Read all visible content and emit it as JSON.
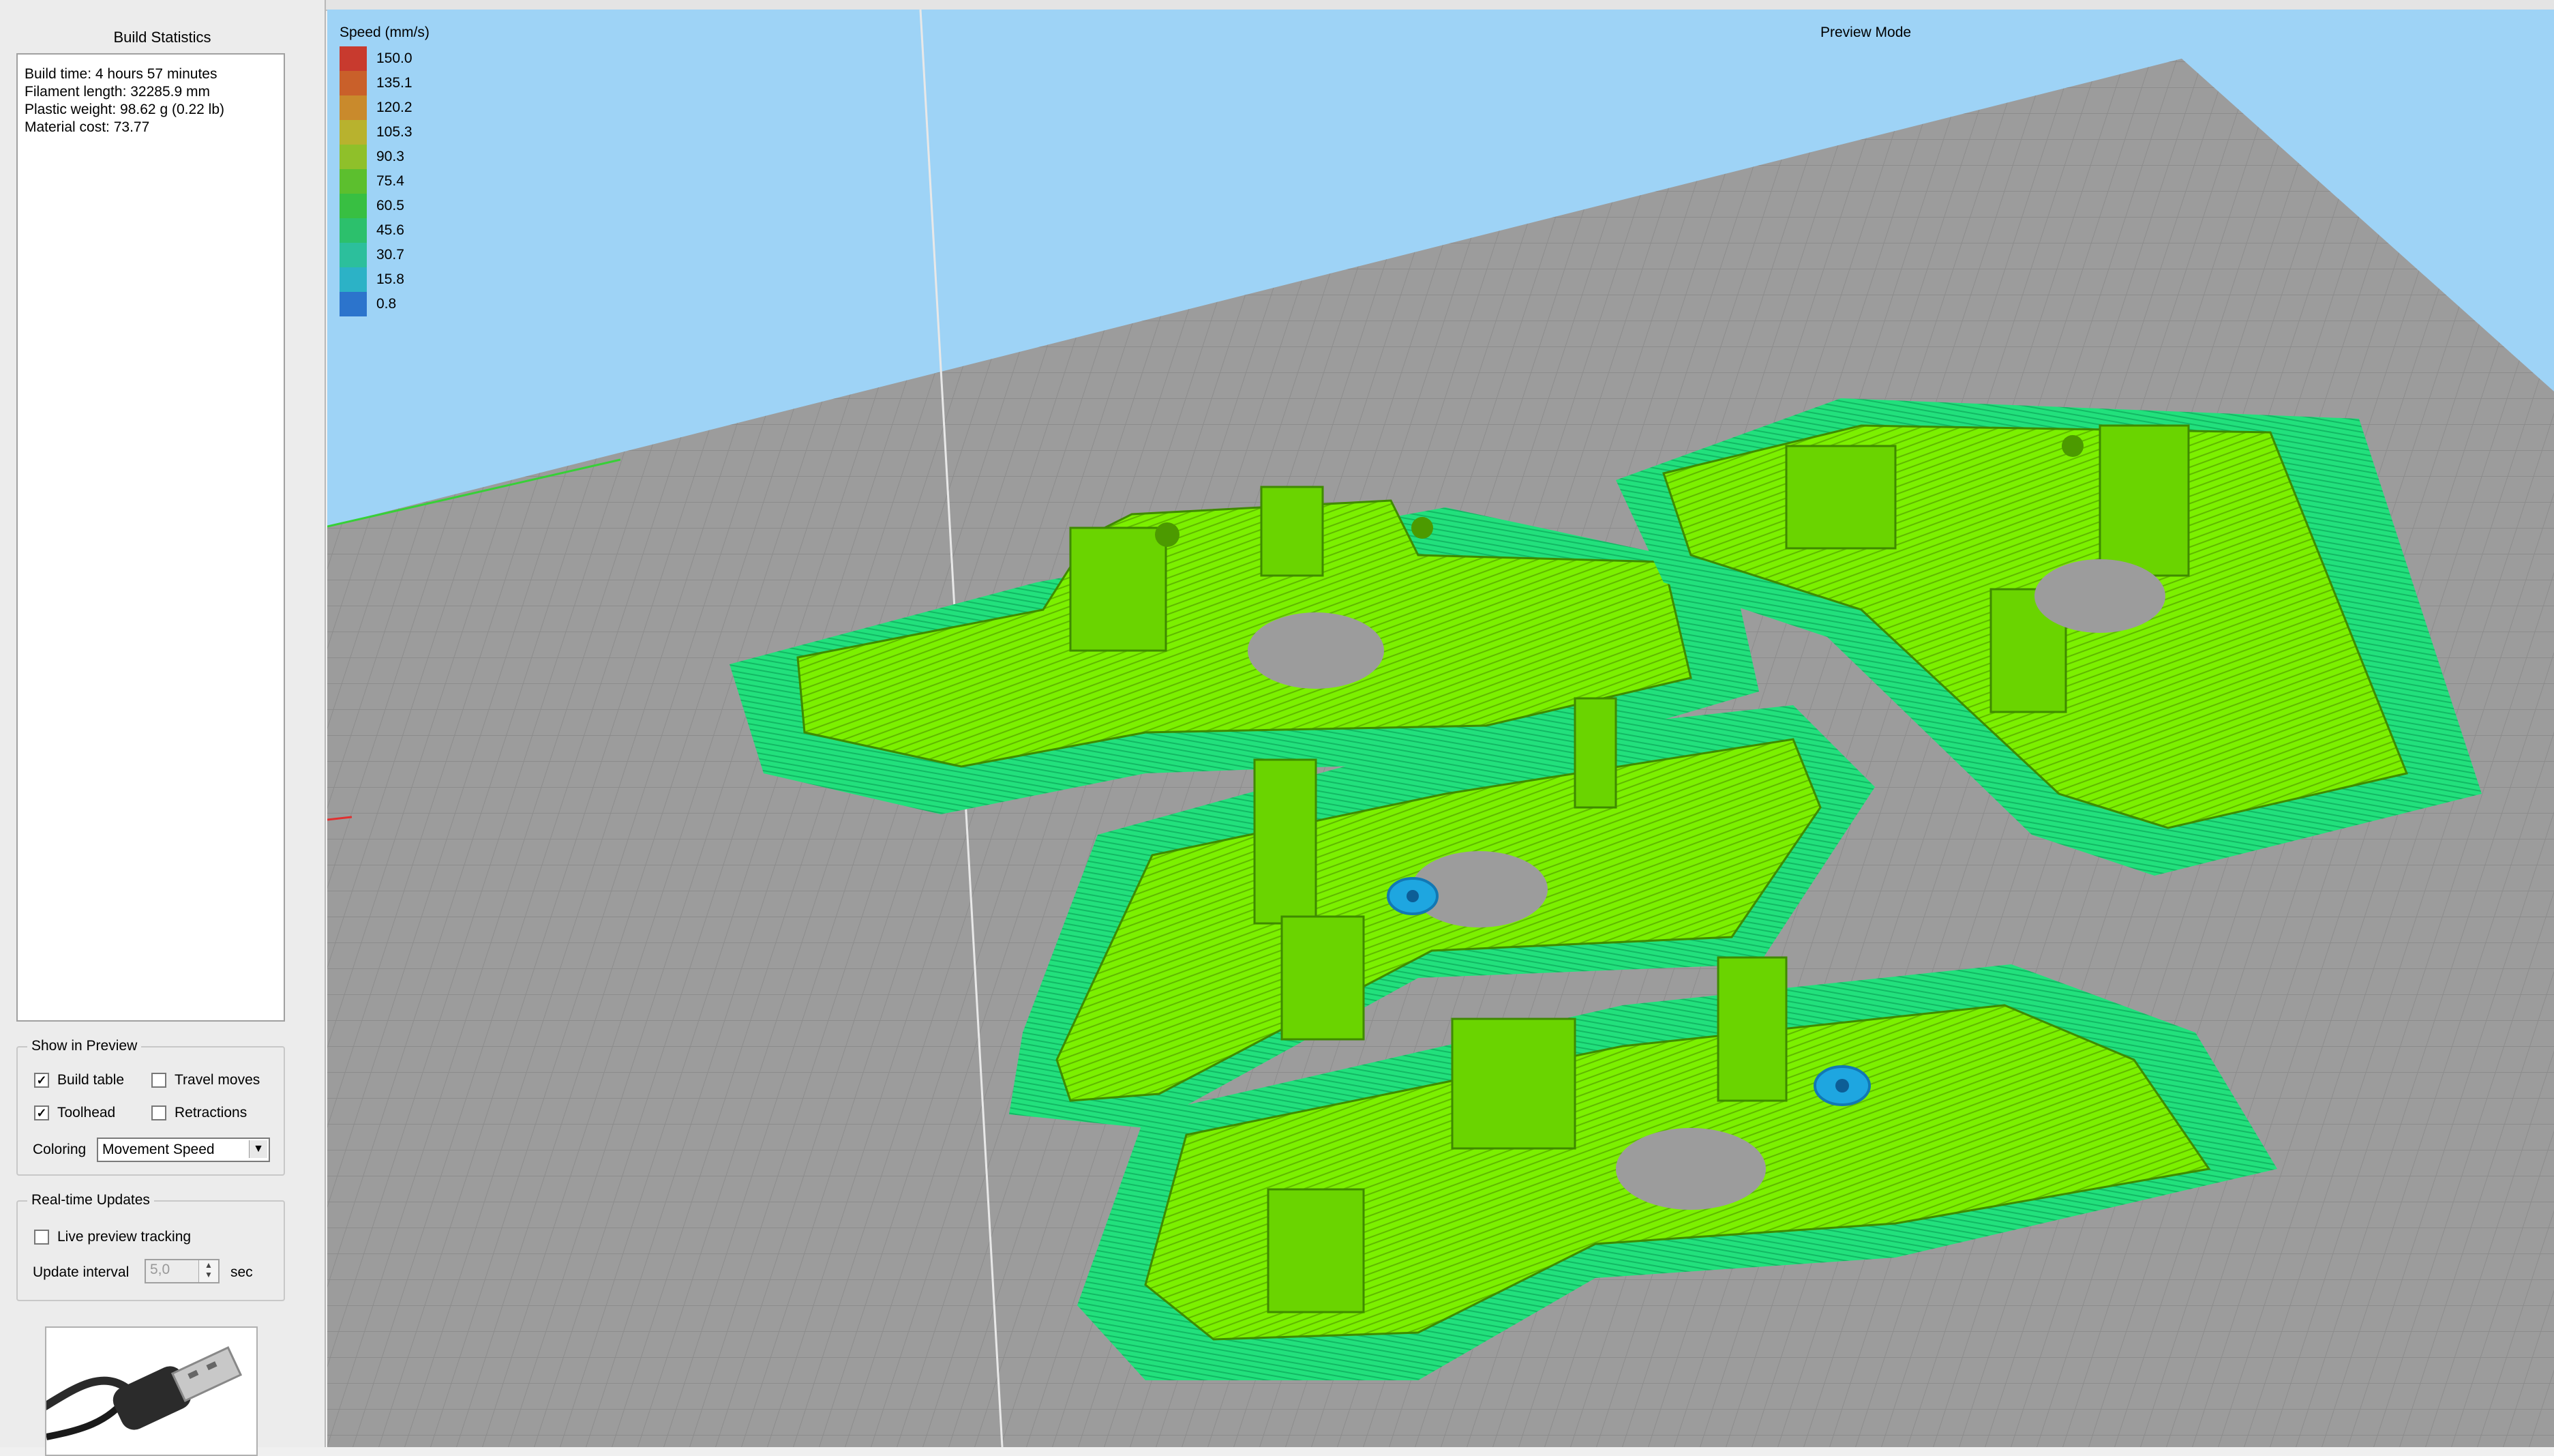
{
  "left_panel": {
    "title": "Build Statistics",
    "stats": {
      "build_time": "Build time: 4 hours 57 minutes",
      "filament_length": "Filament length: 32285.9 mm",
      "plastic_weight": "Plastic weight: 98.62 g (0.22 lb)",
      "material_cost": "Material cost: 73.77"
    },
    "show_in_preview": {
      "title": "Show in Preview",
      "build_table": {
        "label": "Build table",
        "checked": true
      },
      "travel_moves": {
        "label": "Travel moves",
        "checked": false
      },
      "toolhead": {
        "label": "Toolhead",
        "checked": true
      },
      "retractions": {
        "label": "Retractions",
        "checked": false
      },
      "coloring_label": "Coloring",
      "coloring_value": "Movement Speed"
    },
    "realtime_updates": {
      "title": "Real-time Updates",
      "live_preview": {
        "label": "Live preview tracking",
        "checked": false
      },
      "update_interval_label": "Update interval",
      "update_interval_value": "5,0",
      "unit": "sec"
    }
  },
  "viewport": {
    "mode_label": "Preview Mode",
    "legend": {
      "title": "Speed (mm/s)",
      "items": [
        {
          "value": "150.0",
          "color": "#c83a2e"
        },
        {
          "value": "135.1",
          "color": "#c9602a"
        },
        {
          "value": "120.2",
          "color": "#c98a2c"
        },
        {
          "value": "105.3",
          "color": "#b8b22e"
        },
        {
          "value": "90.3",
          "color": "#8fc02a"
        },
        {
          "value": "75.4",
          "color": "#5cbf2e"
        },
        {
          "value": "60.5",
          "color": "#38bf42"
        },
        {
          "value": "45.6",
          "color": "#2cc06c"
        },
        {
          "value": "30.7",
          "color": "#2cbf9c"
        },
        {
          "value": "15.8",
          "color": "#2cb2c6"
        },
        {
          "value": "0.8",
          "color": "#2c74cc"
        }
      ]
    },
    "colors": {
      "background": "#9ed3f6",
      "bed": "#9a9a9a",
      "part": "#7cf000",
      "brim": "#1ee07a"
    }
  }
}
